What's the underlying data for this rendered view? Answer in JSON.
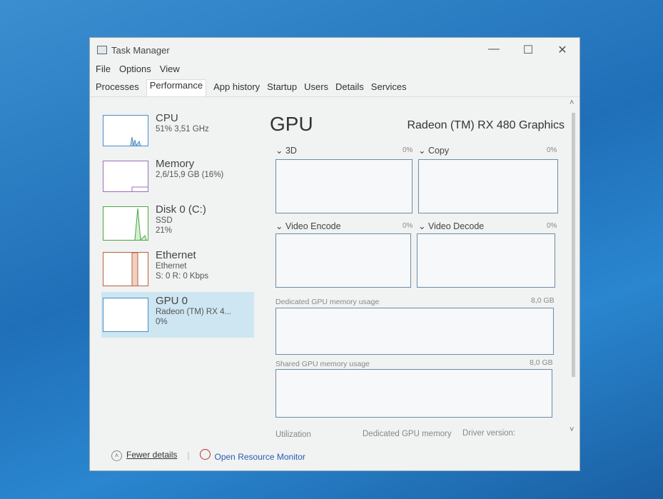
{
  "window": {
    "title": "Task Manager",
    "minimize": "—",
    "maximize": "☐",
    "close": "✕"
  },
  "menu": [
    "File",
    "Options",
    "View"
  ],
  "tabs": [
    "Processes",
    "Performance",
    "App history",
    "Startup",
    "Users",
    "Details",
    "Services"
  ],
  "sidebar": [
    {
      "title": "CPU",
      "line1": "51% 3,51 GHz",
      "line2": "",
      "color": "#4a8dc4"
    },
    {
      "title": "Memory",
      "line1": "2,6/15,9 GB (16%)",
      "line2": "",
      "color": "#9b6fbd"
    },
    {
      "title": "Disk 0 (C:)",
      "line1": "SSD",
      "line2": "21%",
      "color": "#4aa642"
    },
    {
      "title": "Ethernet",
      "line1": "Ethernet",
      "line2": "S: 0 R: 0 Kbps",
      "color": "#b7633d"
    },
    {
      "title": "GPU 0",
      "line1": "Radeon (TM) RX 4...",
      "line2": "0%",
      "color": "#4a8dc4"
    }
  ],
  "main": {
    "title": "GPU",
    "gpu_name": "Radeon (TM) RX 480 Graphics",
    "engines": [
      {
        "label": "3D",
        "pct": "0%"
      },
      {
        "label": "Copy",
        "pct": "0%"
      },
      {
        "label": "Video Encode",
        "pct": "0%"
      },
      {
        "label": "Video Decode",
        "pct": "0%"
      }
    ],
    "dedicated": {
      "label": "Dedicated GPU memory usage",
      "max": "8,0 GB"
    },
    "shared": {
      "label": "Shared GPU memory usage",
      "max": "8,0 GB"
    },
    "stats": [
      "Utilization",
      "Dedicated GPU memory",
      "Driver version:"
    ]
  },
  "footer": {
    "fewer": "Fewer details",
    "monitor": "Open Resource Monitor"
  }
}
